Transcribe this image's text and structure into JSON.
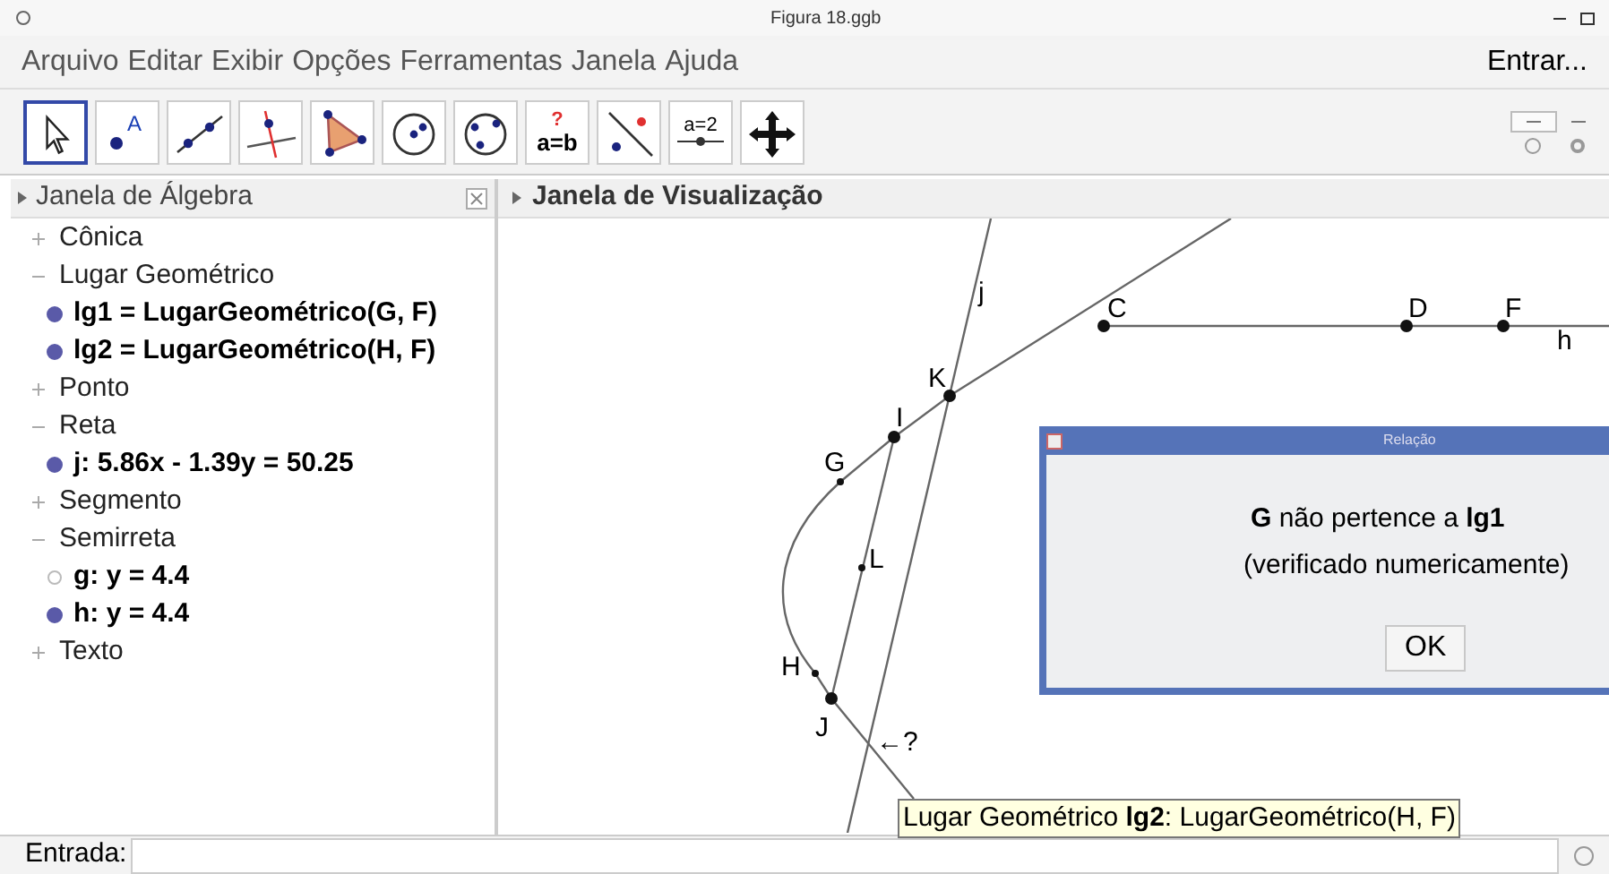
{
  "window": {
    "title": "Figura 18.ggb"
  },
  "menu": [
    "Arquivo",
    "Editar",
    "Exibir",
    "Opções",
    "Ferramentas",
    "Janela",
    "Ajuda"
  ],
  "login": "Entrar...",
  "toolbar": [
    {
      "kind": "move",
      "selected": true
    },
    {
      "kind": "point",
      "selected": false,
      "glyph": "A"
    },
    {
      "kind": "line",
      "selected": false
    },
    {
      "kind": "perpendicular",
      "selected": false
    },
    {
      "kind": "polygon",
      "selected": false
    },
    {
      "kind": "circle",
      "selected": false
    },
    {
      "kind": "circle3",
      "selected": false
    },
    {
      "kind": "relation",
      "selected": false,
      "glyph": "?",
      "glyph2": "a=b"
    },
    {
      "kind": "reflect",
      "selected": false
    },
    {
      "kind": "slider",
      "selected": false,
      "glyph": "a=2"
    },
    {
      "kind": "pan",
      "selected": false
    }
  ],
  "algebra": {
    "title": "Janela de Álgebra",
    "groups": [
      {
        "label": "Cônica",
        "expanded": false
      },
      {
        "label": "Lugar Geométrico",
        "expanded": true,
        "children": [
          {
            "label": "lg1 = LugarGeométrico(G, F)",
            "visible": true
          },
          {
            "label": "lg2 = LugarGeométrico(H, F)",
            "visible": true
          }
        ]
      },
      {
        "label": "Ponto",
        "expanded": false
      },
      {
        "label": "Reta",
        "expanded": true,
        "children": [
          {
            "label": "j: 5.86x - 1.39y = 50.25",
            "visible": true
          }
        ]
      },
      {
        "label": "Segmento",
        "expanded": false
      },
      {
        "label": "Semirreta",
        "expanded": true,
        "children": [
          {
            "label": "g: y = 4.4",
            "visible": false
          },
          {
            "label": "h: y = 4.4",
            "visible": true
          }
        ]
      },
      {
        "label": "Texto",
        "expanded": false
      }
    ]
  },
  "graphics": {
    "title": "Janela de Visualização",
    "points": [
      {
        "label": "C"
      },
      {
        "label": "D"
      },
      {
        "label": "F"
      },
      {
        "label": "K"
      },
      {
        "label": "I"
      },
      {
        "label": "G"
      },
      {
        "label": "L"
      },
      {
        "label": "H"
      },
      {
        "label": "J"
      }
    ],
    "lines": [
      {
        "label": "j"
      },
      {
        "label": "h"
      }
    ],
    "annotation": "←?"
  },
  "dialog": {
    "title": "Relação",
    "message": "**G** não pertence a **lg1**",
    "detail": "(verificado numericamente)",
    "button": "OK"
  },
  "tooltip": "Lugar Geométrico **lg2**: LugarGeométrico(H, F)",
  "input_bar": {
    "label": "Entrada:"
  }
}
